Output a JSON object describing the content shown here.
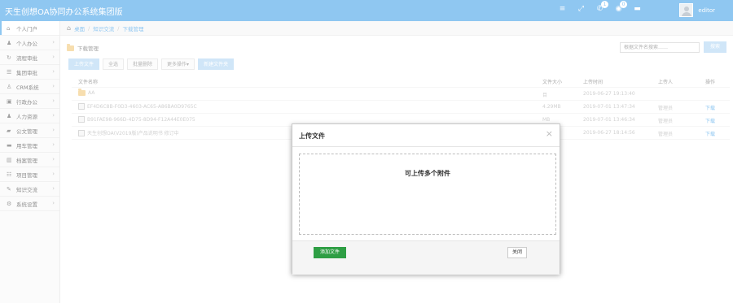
{
  "app": {
    "title": "天生创想OA协同办公系统集团版"
  },
  "header": {
    "icons": [
      {
        "name": "menu-icon",
        "glyph": "≡",
        "badge": ""
      },
      {
        "name": "fullscreen-icon",
        "glyph": "⤢",
        "badge": ""
      },
      {
        "name": "chat-icon",
        "glyph": "✆",
        "badge": "1"
      },
      {
        "name": "notification-icon",
        "glyph": "◉",
        "badge": "0"
      },
      {
        "name": "message-icon",
        "glyph": "▬",
        "badge": ""
      }
    ],
    "username": "editor"
  },
  "sidebar": {
    "items": [
      {
        "label": "个人门户",
        "icon": "⌂",
        "active": true,
        "arrow": ""
      },
      {
        "label": "个人办公",
        "icon": "♟",
        "active": false,
        "arrow": "›"
      },
      {
        "label": "流程审批",
        "icon": "↻",
        "active": false,
        "arrow": "›"
      },
      {
        "label": "集团审批",
        "icon": "☰",
        "active": false,
        "arrow": "›"
      },
      {
        "label": "CRM系统",
        "icon": "♙",
        "active": false,
        "arrow": "›"
      },
      {
        "label": "行政办公",
        "icon": "▣",
        "active": false,
        "arrow": "›"
      },
      {
        "label": "人力资源",
        "icon": "♟",
        "active": false,
        "arrow": "›"
      },
      {
        "label": "公文管理",
        "icon": "▰",
        "active": false,
        "arrow": "›"
      },
      {
        "label": "用车管理",
        "icon": "▬",
        "active": false,
        "arrow": "›"
      },
      {
        "label": "档案管理",
        "icon": "▥",
        "active": false,
        "arrow": "›"
      },
      {
        "label": "项目管理",
        "icon": "☷",
        "active": false,
        "arrow": "›"
      },
      {
        "label": "知识交流",
        "icon": "✎",
        "active": false,
        "arrow": "›"
      },
      {
        "label": "系统设置",
        "icon": "⚙",
        "active": false,
        "arrow": "›"
      }
    ]
  },
  "breadcrumb": {
    "home": "桌面",
    "level1": "知识交流",
    "level2": "下载管理",
    "sep": "/"
  },
  "panel": {
    "title": "下载管理",
    "search_placeholder": "根据文件名搜索……",
    "search_button": "搜索"
  },
  "toolbar": {
    "upload": "上传文件",
    "select_all": "全选",
    "batch_delete": "批量删除",
    "more": "更多操作▾",
    "new_folder": "新建文件夹"
  },
  "table": {
    "headers": {
      "name": "文件名称",
      "size": "文件大小",
      "time": "上传时间",
      "uploader": "上传人",
      "op": "操作"
    },
    "rows": [
      {
        "name": "AA",
        "size": "目",
        "time": "2019-06-27 19:13:40",
        "uploader": "",
        "op": "",
        "type": "folder"
      },
      {
        "name": "EF4D6C8B-F0D3-4603-AC65-A86BA0D9765C",
        "size": "4.29MB",
        "time": "2019-07-01 13:47:34",
        "uploader": "管理员",
        "op": "下载",
        "type": "file"
      },
      {
        "name": "B91FAE98-966D-4D75-8D94-F12A44E0E075",
        "size": "MB",
        "time": "2019-07-01 13:46:34",
        "uploader": "管理员",
        "op": "下载",
        "type": "file"
      },
      {
        "name": "天生创想OA(V2019版)产品说明书 修订中",
        "size": "MB",
        "time": "2019-06-27 18:14:56",
        "uploader": "管理员",
        "op": "下载",
        "type": "file"
      }
    ]
  },
  "modal": {
    "title": "上传文件",
    "close_glyph": "×",
    "drop_text": "可上传多个附件",
    "add_button": "添加文件",
    "close_button": "关闭"
  },
  "colors": {
    "brand": "#3399e6",
    "success": "#2e9e44"
  }
}
